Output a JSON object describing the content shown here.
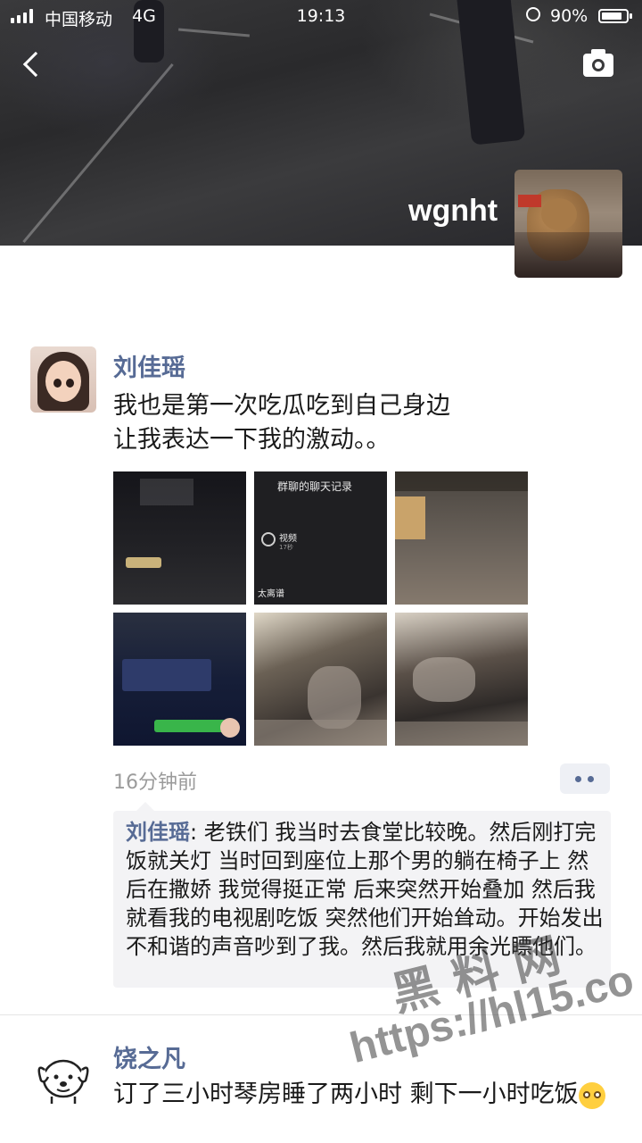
{
  "status_bar": {
    "carrier": "中国移动",
    "network": "4G",
    "time": "19:13",
    "battery": "90%"
  },
  "cover": {
    "username": "wgnht"
  },
  "post1": {
    "author": "刘佳瑶",
    "text_line1": "我也是第一次吃瓜吃到自己身边",
    "text_line2": "让我表达一下我的激动。。",
    "images": [
      {
        "title": "",
        "desc": "chat screenshot"
      },
      {
        "title": "群聊的聊天记录",
        "video_label": "视频",
        "video_len": "17秒",
        "footer": "太离谱"
      },
      {
        "desc": "cafeteria"
      },
      {
        "desc": "chat screenshot"
      },
      {
        "desc": "cafeteria photo"
      },
      {
        "desc": "cafeteria photo"
      }
    ],
    "timestamp": "16分钟前",
    "comment_author": "刘佳瑶",
    "comment_text": "老铁们 我当时去食堂比较晚。然后刚打完饭就关灯 当时回到座位上那个男的躺在椅子上 然后在撒娇 我觉得挺正常 后来突然开始叠加 然后我就看我的电视剧吃饭 突然他们开始耸动。开始发出不和谐的声音吵到了我。然后我就用余光瞟他们。"
  },
  "post2": {
    "author": "饶之凡",
    "text": "订了三小时琴房睡了两小时 剩下一小时吃饭"
  },
  "watermark": {
    "line1": "黑料网",
    "line2": "https://hl15.co"
  },
  "colors": {
    "link": "#576b95",
    "text": "#1a1a1a",
    "meta": "#9b9b9b"
  }
}
